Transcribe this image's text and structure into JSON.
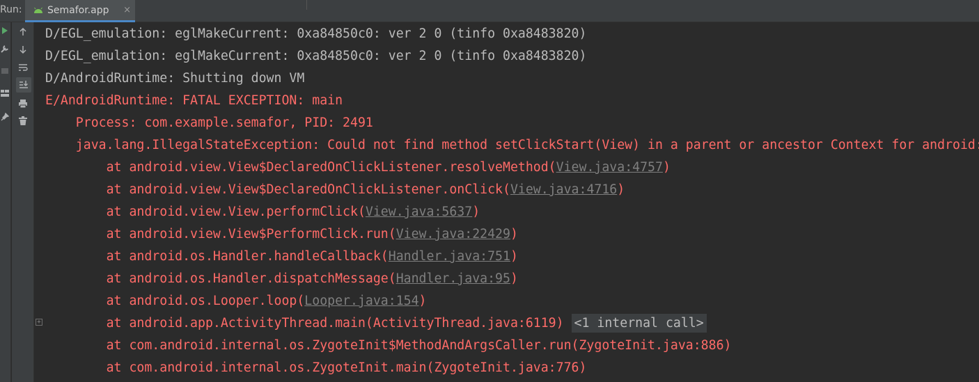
{
  "tabbar": {
    "run_label": "Run:",
    "tab_label": "Semafor.app",
    "tab_close": "×",
    "icon": "android-icon"
  },
  "toolbar": {
    "icons": [
      "run-icon",
      "wrench-icon",
      "stop-icon",
      "layout-icon",
      "pin-icon"
    ],
    "console_icons": [
      "arrow-up-icon",
      "arrow-down-icon",
      "soft-wrap-icon",
      "scroll-to-end-icon",
      "print-icon",
      "trash-icon"
    ]
  },
  "console": {
    "lines": [
      {
        "text": "D/EGL_emulation: eglMakeCurrent: 0xa84850c0: ver 2 0 (tinfo 0xa8483820)",
        "type": "normal"
      },
      {
        "text": "D/EGL_emulation: eglMakeCurrent: 0xa84850c0: ver 2 0 (tinfo 0xa8483820)",
        "type": "normal"
      },
      {
        "text": "D/AndroidRuntime: Shutting down VM",
        "type": "normal"
      },
      {
        "text": "E/AndroidRuntime: FATAL EXCEPTION: main",
        "type": "error"
      },
      {
        "text": "    Process: com.example.semafor, PID: 2491",
        "type": "error"
      },
      {
        "text": "    java.lang.IllegalStateException: Could not find method setClickStart(View) in a parent or ancestor Context for android:onClick attribute",
        "type": "error"
      },
      {
        "prefix": "        at android.view.View$DeclaredOnClickListener.resolveMethod(",
        "link": "View.java:4757",
        "suffix": ")",
        "type": "error"
      },
      {
        "prefix": "        at android.view.View$DeclaredOnClickListener.onClick(",
        "link": "View.java:4716",
        "suffix": ")",
        "type": "error"
      },
      {
        "prefix": "        at android.view.View.performClick(",
        "link": "View.java:5637",
        "suffix": ")",
        "type": "error"
      },
      {
        "prefix": "        at android.view.View$PerformClick.run(",
        "link": "View.java:22429",
        "suffix": ")",
        "type": "error"
      },
      {
        "prefix": "        at android.os.Handler.handleCallback(",
        "link": "Handler.java:751",
        "suffix": ")",
        "type": "error"
      },
      {
        "prefix": "        at android.os.Handler.dispatchMessage(",
        "link": "Handler.java:95",
        "suffix": ")",
        "type": "error"
      },
      {
        "prefix": "        at android.os.Looper.loop(",
        "link": "Looper.java:154",
        "suffix": ")",
        "type": "error"
      },
      {
        "text": "        at android.app.ActivityThread.main(ActivityThread.java:6119)",
        "internal": "<1 internal call>",
        "type": "error"
      },
      {
        "text": "        at com.android.internal.os.ZygoteInit$MethodAndArgsCaller.run(ZygoteInit.java:886)",
        "type": "error"
      },
      {
        "text": "        at com.android.internal.os.ZygoteInit.main(ZygoteInit.java:776)",
        "type": "error"
      }
    ],
    "fold_marker": "+"
  },
  "colors": {
    "error": "#ff6b68",
    "normal": "#bbbbbb",
    "link": "#7f7f7f",
    "background": "#2b2b2b",
    "accent": "#4a88c7"
  }
}
